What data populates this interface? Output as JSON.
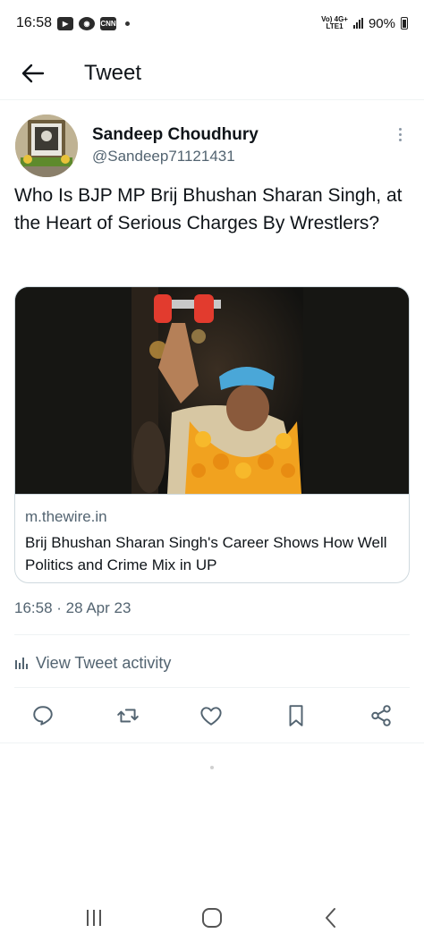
{
  "status_bar": {
    "time": "16:58",
    "icons": [
      "youtube-icon",
      "chrome-icon",
      "cnn-icon"
    ],
    "cnn_label": "CNN",
    "network_top": "Vo) 4G+",
    "network_bottom": "LTE1",
    "battery": "90%"
  },
  "header": {
    "title": "Tweet"
  },
  "tweet": {
    "author_name": "Sandeep Choudhury",
    "author_handle": "@Sandeep71121431",
    "text": "Who Is BJP MP Brij Bhushan Sharan Singh, at the Heart of Serious Charges By Wrestlers?",
    "timestamp": "16:58 · 28 Apr 23",
    "card": {
      "domain": "m.thewire.in",
      "title": "Brij Bhushan Sharan Singh's Career Shows How Well Politics and Crime Mix in UP"
    },
    "activity_label": "View Tweet activity"
  },
  "actions": [
    "reply-icon",
    "retweet-icon",
    "like-icon",
    "bookmark-icon",
    "share-icon"
  ],
  "colors": {
    "text_primary": "#0f1419",
    "text_secondary": "#536471",
    "border": "#cfd9de",
    "divider": "#eff3f4"
  }
}
